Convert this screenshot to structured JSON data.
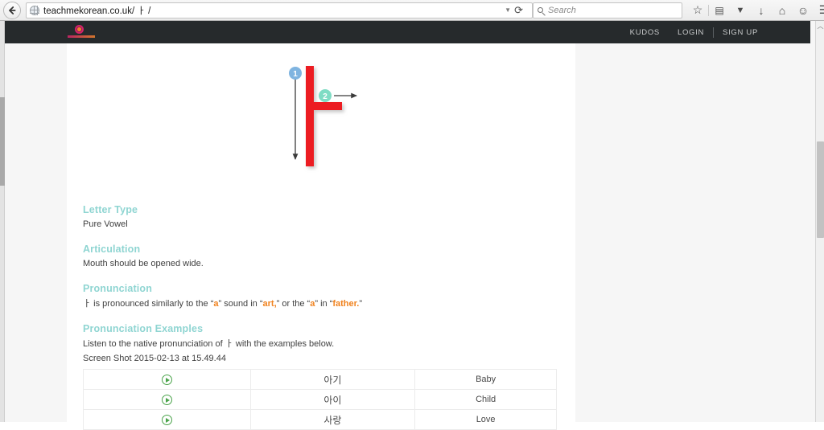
{
  "browser": {
    "back_icon": "back-arrow-icon",
    "site_icon": "globe-icon",
    "url": "teachmekorean.co.uk/ ㅏ /",
    "url_dropdown_icon": "chevron-down-icon",
    "reload_icon": "reload-icon",
    "reload_glyph": "⟳",
    "search_icon": "search-icon",
    "search_placeholder": "Search",
    "toolbar_icons": [
      {
        "name": "bookmark-star-icon",
        "glyph": "☆"
      },
      {
        "name": "library-icon",
        "glyph": "▤"
      },
      {
        "name": "pocket-icon",
        "glyph": "▼"
      },
      {
        "name": "downloads-icon",
        "glyph": "↓"
      },
      {
        "name": "home-icon",
        "glyph": "⌂"
      },
      {
        "name": "feedback-smiley-icon",
        "glyph": "☺"
      },
      {
        "name": "menu-hamburger-icon",
        "glyph": "☰"
      }
    ]
  },
  "site_header": {
    "logo_name": "teachmekorean-logo",
    "nav": [
      {
        "label": "KUDOS"
      },
      {
        "label": "LOGIN"
      },
      {
        "label": "SIGN UP"
      }
    ]
  },
  "diagram": {
    "letter": "ㅏ",
    "letter_color": "#ec1c20",
    "strokes": [
      {
        "number": "1",
        "badge_color": "#7fb4e0",
        "direction": "down"
      },
      {
        "number": "2",
        "badge_color": "#7fdcc4",
        "direction": "right"
      }
    ]
  },
  "article": {
    "sections": [
      {
        "heading": "Letter Type",
        "body": "Pure Vowel"
      },
      {
        "heading": "Articulation",
        "body": "Mouth should be opened wide."
      }
    ],
    "pronunciation": {
      "heading": "Pronunciation",
      "jamo": "ㅏ",
      "part1": " is pronounced similarly to the “",
      "hl1": "a",
      "part2": "” sound in “",
      "hl2": "art,",
      "part3": "” or the “",
      "hl3": "a",
      "part4": "” in “",
      "hl4": "father.",
      "part5": "”"
    },
    "examples": {
      "heading": "Pronunciation Examples",
      "intro_part1": "Listen to the native pronunciation of ",
      "intro_jamo": "ㅏ",
      "intro_part2": " with the examples below.",
      "alt_text": "Screen Shot 2015-02-13 at 15.49.44"
    }
  },
  "table": {
    "audio_icon": "play-audio-icon",
    "rows": [
      {
        "korean": "아기",
        "english": "Baby"
      },
      {
        "korean": "아이",
        "english": "Child"
      },
      {
        "korean": "사랑",
        "english": "Love"
      }
    ]
  },
  "scrollbar": {
    "up_glyph": "︿"
  },
  "colors": {
    "heading_teal": "#8fd5d2",
    "highlight_orange": "#f0821e",
    "header_dark": "#262a2c",
    "letter_red": "#ec1c20",
    "audio_green": "#4aa34a"
  }
}
